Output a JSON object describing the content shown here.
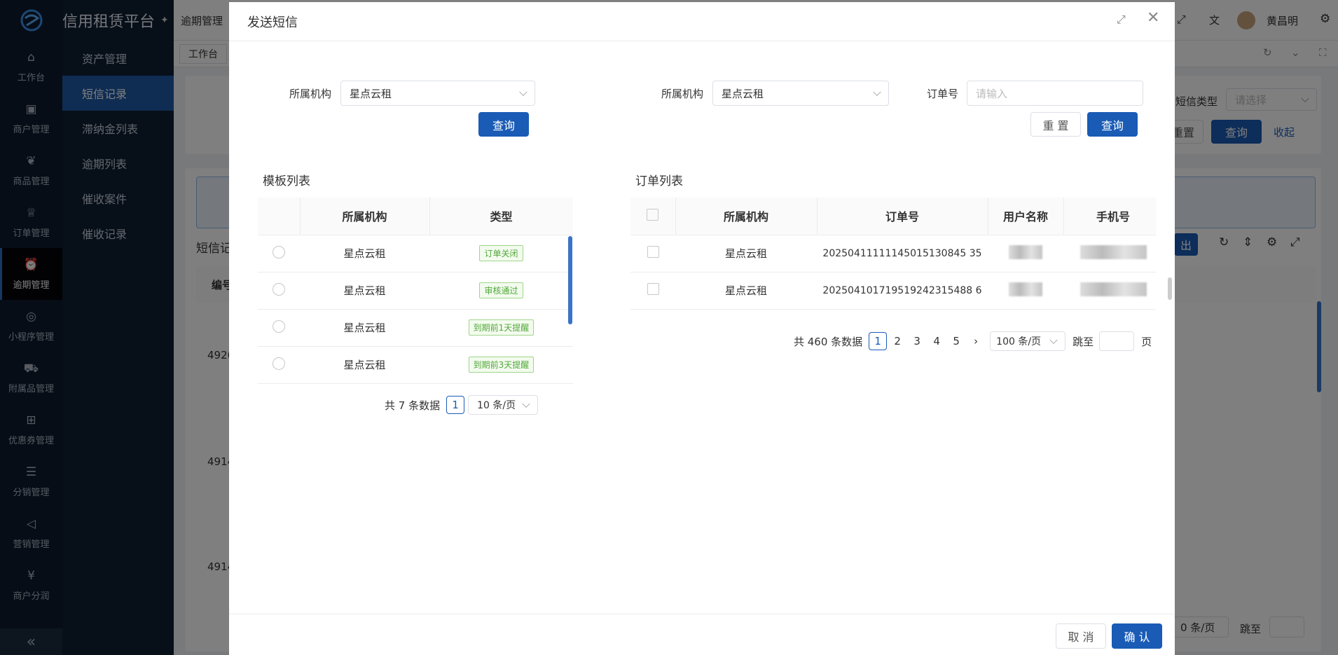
{
  "app": {
    "title": "信用租赁平台"
  },
  "nav": {
    "items": [
      {
        "label": "工作台",
        "icon": "home-icon"
      },
      {
        "label": "商户管理",
        "icon": "briefcase-icon"
      },
      {
        "label": "商品管理",
        "icon": "apple-icon"
      },
      {
        "label": "订单管理",
        "icon": "trophy-icon"
      },
      {
        "label": "逾期管理",
        "icon": "alarm-icon"
      },
      {
        "label": "小程序管理",
        "icon": "mini-program-icon"
      },
      {
        "label": "附属品管理",
        "icon": "cart-icon"
      },
      {
        "label": "优惠券管理",
        "icon": "gift-icon"
      },
      {
        "label": "分销管理",
        "icon": "sliders-icon"
      },
      {
        "label": "营销管理",
        "icon": "megaphone-icon"
      },
      {
        "label": "商户分润",
        "icon": "yen-icon"
      }
    ],
    "collapse_symbol": "«"
  },
  "subnav": {
    "items": [
      "资产管理",
      "短信记录",
      "滞纳金列表",
      "逾期列表",
      "催收案件",
      "催收记录"
    ]
  },
  "topbar": {
    "breadcrumb": "逾期管理",
    "user_name": "黄昌明"
  },
  "tabs": {
    "workbench": "工作台"
  },
  "background": {
    "filter_label": "短信类型",
    "filter_placeholder": "请选择",
    "reset": "重置",
    "query": "查询",
    "collapse": "收起",
    "section": "短信记",
    "col_id": "编号",
    "row_ids": [
      "4926",
      "4914",
      "4914"
    ],
    "export": "出",
    "page_size": "0 条/页",
    "jump": "跳至"
  },
  "modal": {
    "title": "发送短信",
    "left": {
      "org_label": "所属机构",
      "org_value": "星点云租",
      "query": "查询",
      "section_title": "模板列表",
      "columns": [
        "所属机构",
        "类型"
      ],
      "rows": [
        {
          "org": "星点云租",
          "type": "订单关闭"
        },
        {
          "org": "星点云租",
          "type": "审核通过"
        },
        {
          "org": "星点云租",
          "type": "到期前1天提醒"
        },
        {
          "org": "星点云租",
          "type": "到期前3天提醒"
        }
      ],
      "total": "共 7 条数据",
      "page": "1",
      "page_size": "10 条/页"
    },
    "right": {
      "org_label": "所属机构",
      "org_value": "星点云租",
      "order_label": "订单号",
      "order_placeholder": "请输入",
      "reset": "重 置",
      "query": "查询",
      "section_title": "订单列表",
      "columns": [
        "所属机构",
        "订单号",
        "用户名称",
        "手机号"
      ],
      "rows": [
        {
          "org": "星点云租",
          "order_no": "20250411111145015130845 35"
        },
        {
          "org": "星点云租",
          "order_no": "202504101719519242315488 6"
        }
      ],
      "total": "共 460 条数据",
      "pages": [
        "1",
        "2",
        "3",
        "4",
        "5"
      ],
      "page_size": "100 条/页",
      "jump_label": "跳至",
      "page_unit": "页"
    },
    "footer": {
      "cancel": "取 消",
      "confirm": "确 认"
    }
  }
}
